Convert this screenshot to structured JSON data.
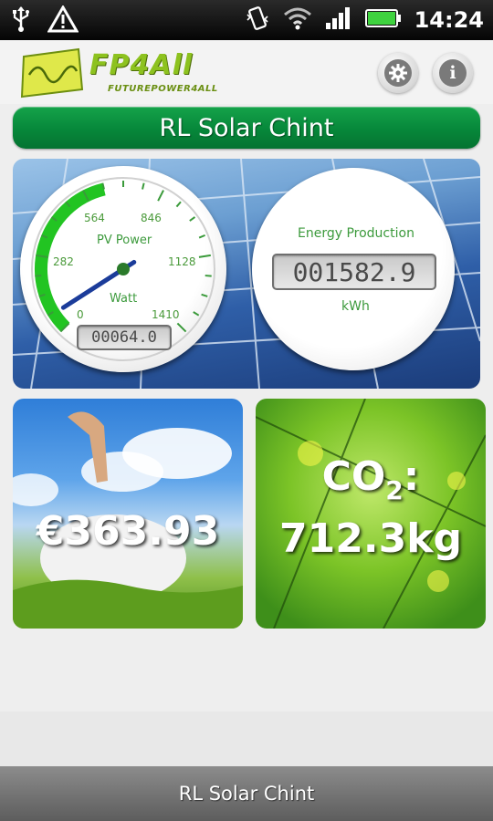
{
  "status_bar": {
    "time": "14:24",
    "icons": [
      "usb-icon",
      "warning-icon",
      "vibrate-icon",
      "wifi-icon",
      "signal-icon",
      "battery-icon"
    ]
  },
  "header": {
    "logo_text": "FP4All",
    "logo_subtext": "FUTUREPOWER4ALL",
    "settings_icon": "gear-icon",
    "info_icon": "info-icon",
    "info_glyph": "i"
  },
  "title": "RL Solar Chint",
  "pv_gauge": {
    "title": "PV Power",
    "unit": "Watt",
    "ticks": [
      "0",
      "282",
      "564",
      "846",
      "1128",
      "1410"
    ],
    "max": 1410,
    "value": 64,
    "readout": "00064.0"
  },
  "energy": {
    "title": "Energy Production",
    "readout": "001582.9",
    "unit": "kWh"
  },
  "savings": {
    "value": "€363.93"
  },
  "co2": {
    "label": "CO",
    "subscript": "2",
    "suffix": ":",
    "value": "712.3kg"
  },
  "bottom_bar": {
    "label": "RL Solar Chint"
  },
  "colors": {
    "brand_green": "#06873a",
    "logo_green": "#8dc21f",
    "gauge_green": "#22c422",
    "needle_blue": "#1b3c9a"
  }
}
